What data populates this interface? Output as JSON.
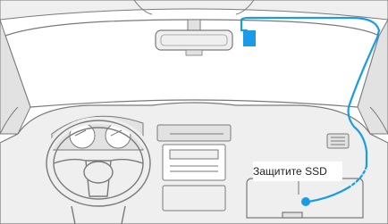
{
  "callout": {
    "text": "Защитите SSD"
  },
  "colors": {
    "cable": "#1a9be8",
    "line_art": "#7a7a7a",
    "fill_light": "#efefef",
    "fill_mid": "#e2e2e2",
    "background": "#ffffff"
  },
  "icons": {
    "dashcam": "dashcam-icon",
    "mirror": "rear-view-mirror-icon",
    "steering_wheel": "steering-wheel-icon",
    "ssd": "ssd-drive-icon"
  }
}
